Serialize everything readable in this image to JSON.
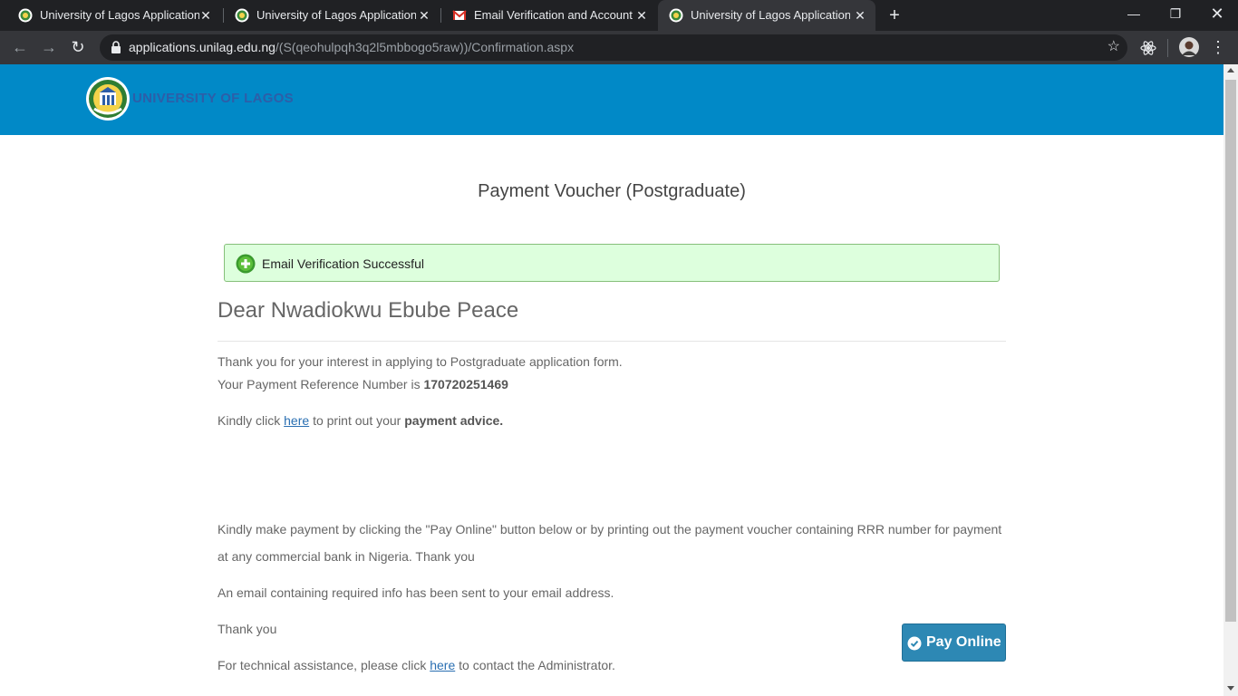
{
  "browser": {
    "tabs": [
      {
        "title": "University of Lagos Application P",
        "icon": "unilag-favicon"
      },
      {
        "title": "University of Lagos Application P",
        "icon": "unilag-favicon"
      },
      {
        "title": "Email Verification and Account A",
        "icon": "gmail-icon"
      },
      {
        "title": "University of Lagos Application P",
        "icon": "unilag-favicon"
      }
    ],
    "active_tab": 3,
    "url_host": "applications.unilag.edu.ng",
    "url_path": "/(S(qeohulpqh3q2l5mbbogo5raw))/Confirmation.aspx"
  },
  "header": {
    "brand": "UNIVERSITY OF LAGOS",
    "background": "#0189c7"
  },
  "main": {
    "title": "Payment Voucher (Postgraduate)",
    "alert": "Email Verification Successful",
    "greeting": "Dear Nwadiokwu Ebube Peace",
    "interest": "Thank you for your interest in applying to Postgraduate application form.",
    "ref_prefix": "Your Payment Reference Number is",
    "ref_number": "170720251469",
    "advice_prefix": "Kindly click",
    "advice_link": "here",
    "advice_middle": "to print out your",
    "advice_bold": "payment advice.",
    "instructions_line1": "Kindly make payment by clicking the \"Pay Online\" button below or by printing out the payment voucher containing RRR number for payment",
    "instructions_line2": "at any commercial bank in Nigeria. Thank you",
    "email_sent": "An email containing required info has been sent to your email address.",
    "thanks": "Thank you",
    "help_prefix": "For technical assistance, please click",
    "help_link": "here",
    "help_suffix": "to contact the Administrator.",
    "pay_button": "Pay Online"
  }
}
